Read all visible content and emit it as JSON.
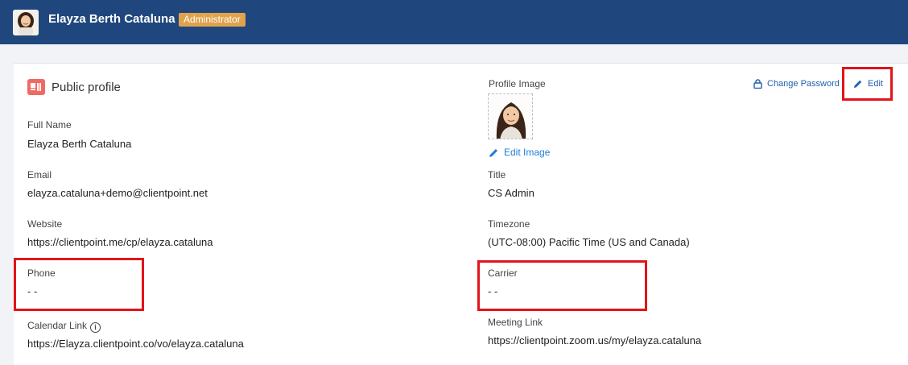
{
  "header": {
    "user_name": "Elayza Berth Cataluna",
    "role_badge": "Administrator",
    "colors": {
      "bar": "#1f477e",
      "badge": "#e0a34b"
    }
  },
  "section": {
    "title": "Public profile",
    "icon": "id-card-icon"
  },
  "actions": {
    "change_password": "Change Password",
    "edit": "Edit",
    "edit_image": "Edit Image"
  },
  "left": {
    "full_name": {
      "label": "Full Name",
      "value": "Elayza Berth Cataluna"
    },
    "email": {
      "label": "Email",
      "value": "elayza.cataluna+demo@clientpoint.net"
    },
    "website": {
      "label": "Website",
      "value": "https://clientpoint.me/cp/elayza.cataluna"
    },
    "phone": {
      "label": "Phone",
      "value": "- -"
    },
    "calendar_link": {
      "label": "Calendar Link",
      "value": "https://Elayza.clientpoint.co/vo/elayza.cataluna"
    }
  },
  "right": {
    "profile_image": {
      "label": "Profile Image"
    },
    "title": {
      "label": "Title",
      "value": "CS Admin"
    },
    "timezone": {
      "label": "Timezone",
      "value": "(UTC-08:00) Pacific Time (US and Canada)"
    },
    "carrier": {
      "label": "Carrier",
      "value": "- -"
    },
    "meeting_link": {
      "label": "Meeting Link",
      "value": "https://clientpoint.zoom.us/my/elayza.cataluna"
    }
  }
}
